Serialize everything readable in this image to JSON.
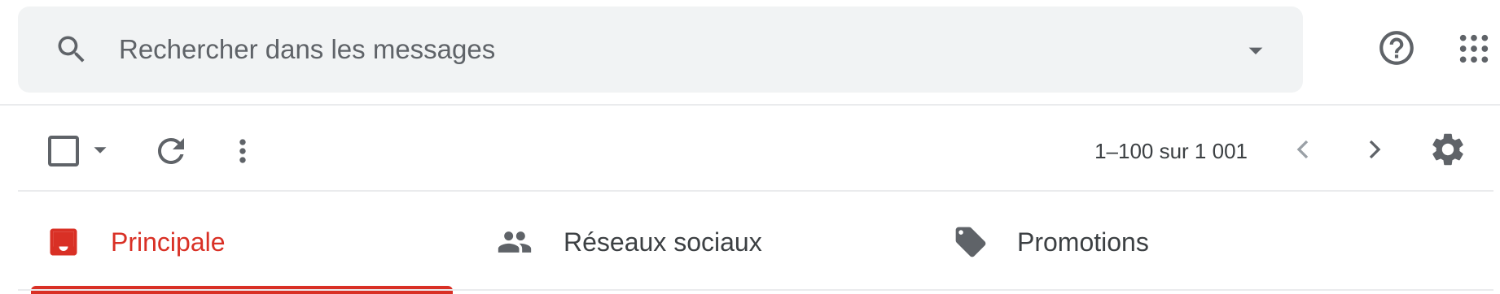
{
  "search": {
    "placeholder": "Rechercher dans les messages",
    "value": ""
  },
  "icons": {
    "search": "search-icon",
    "search_options": "arrow-drop-down-icon",
    "help": "help-circle-icon",
    "apps": "apps-grid-icon",
    "select": "checkbox-icon",
    "select_menu": "arrow-drop-down-icon",
    "refresh": "refresh-icon",
    "more": "more-vert-icon",
    "prev": "chevron-left-icon",
    "next": "chevron-right-icon",
    "settings": "gear-icon"
  },
  "toolbar": {
    "pagination": "1–100 sur 1 001"
  },
  "tabs": [
    {
      "label": "Principale",
      "icon": "inbox-icon",
      "active": true
    },
    {
      "label": "Réseaux sociaux",
      "icon": "people-icon",
      "active": false
    },
    {
      "label": "Promotions",
      "icon": "tag-icon",
      "active": false
    }
  ],
  "colors": {
    "accent": "#d93025",
    "icon": "#5f6368",
    "search_bg": "#f1f3f4",
    "text_primary": "#3c4043"
  }
}
